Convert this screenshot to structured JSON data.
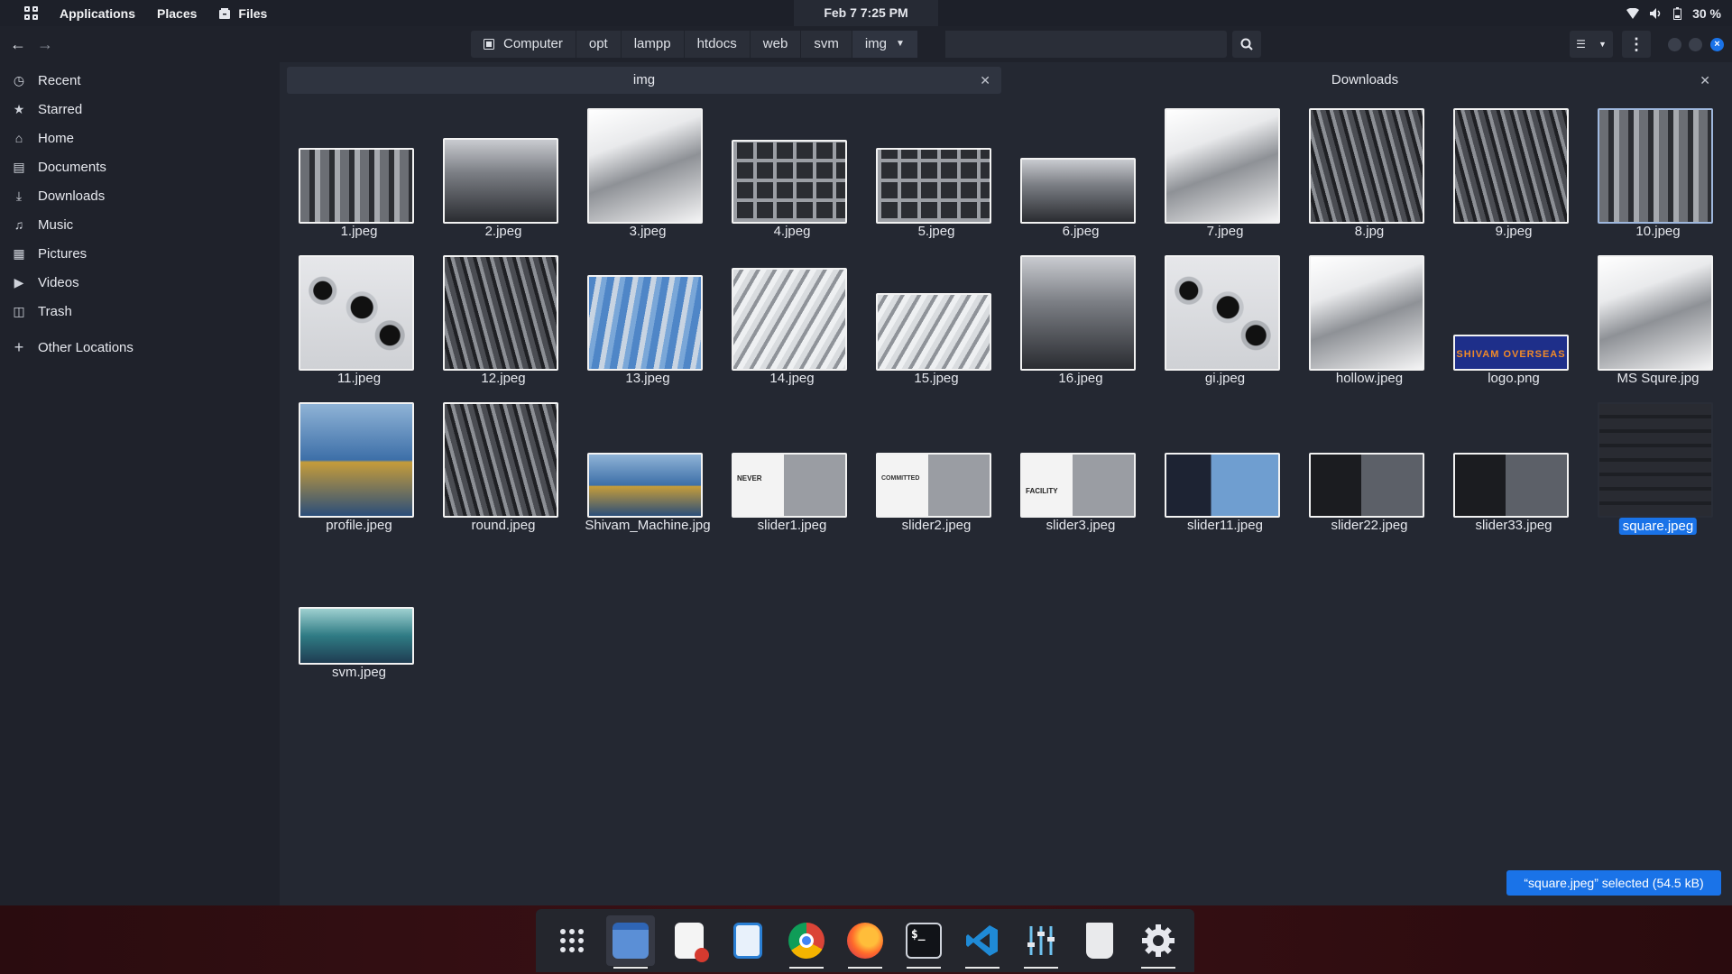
{
  "topbar": {
    "applications": "Applications",
    "places": "Places",
    "files": "Files",
    "clock": "Feb 7  7:25 PM",
    "battery": "30 %"
  },
  "pathbar": {
    "crumbs": [
      "Computer",
      "opt",
      "lampp",
      "htdocs",
      "web",
      "svm",
      "img"
    ]
  },
  "sidebar": {
    "items": [
      {
        "label": "Recent",
        "icon": "clock-icon"
      },
      {
        "label": "Starred",
        "icon": "star-icon"
      },
      {
        "label": "Home",
        "icon": "home-icon"
      },
      {
        "label": "Documents",
        "icon": "document-icon"
      },
      {
        "label": "Downloads",
        "icon": "download-icon"
      },
      {
        "label": "Music",
        "icon": "music-icon"
      },
      {
        "label": "Pictures",
        "icon": "picture-icon"
      },
      {
        "label": "Videos",
        "icon": "video-icon"
      },
      {
        "label": "Trash",
        "icon": "trash-icon"
      }
    ],
    "other_locations": "Other Locations"
  },
  "tabs": {
    "img": "img",
    "downloads": "Downloads"
  },
  "files": [
    "1.jpeg",
    "2.jpeg",
    "3.jpeg",
    "4.jpeg",
    "5.jpeg",
    "6.jpeg",
    "7.jpeg",
    "8.jpg",
    "9.jpeg",
    "10.jpeg",
    "11.jpeg",
    "12.jpeg",
    "13.jpeg",
    "14.jpeg",
    "15.jpeg",
    "16.jpeg",
    "gi.jpeg",
    "hollow.jpeg",
    "logo.png",
    "MS Squre.jpg",
    "profile.jpeg",
    "round.jpeg",
    "Shivam_Machine.jpg",
    "slider1.jpeg",
    "slider2.jpeg",
    "slider3.jpeg",
    "slider11.jpeg",
    "slider22.jpeg",
    "slider33.jpeg",
    "square.jpeg",
    "svm.jpeg"
  ],
  "selected_file": "square.jpeg",
  "thumb_text": {
    "logo": "SHIVAM OVERSEAS",
    "slider1": "NEVER",
    "slider2": "COMMITTED",
    "slider3": "FACILITY"
  },
  "status": "“square.jpeg” selected  (54.5 kB)",
  "dock": [
    "app-grid",
    "files",
    "text-editor",
    "libreoffice",
    "chrome",
    "firefox",
    "terminal",
    "vscode",
    "mixer",
    "trash",
    "settings"
  ],
  "colors": {
    "accent": "#1a73e8",
    "background": "#242832",
    "sidebar": "#1f222b"
  }
}
